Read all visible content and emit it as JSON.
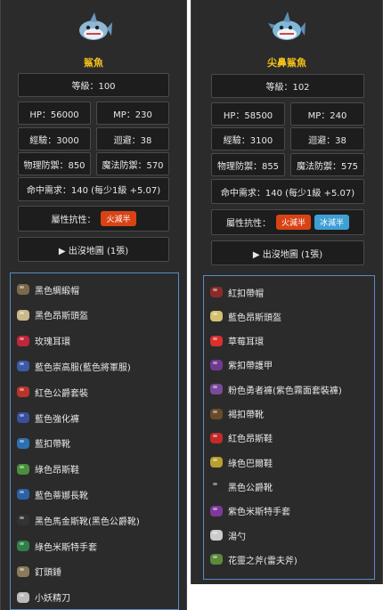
{
  "left": {
    "name": "鯊魚",
    "level": "等級：100",
    "hp": "HP：56000",
    "mp": "MP：230",
    "exp": "經驗：3000",
    "evasion": "迴避：38",
    "phys_def": "物理防禦：850",
    "magic_def": "魔法防禦：570",
    "accuracy": "命中需求：140 (每少1級 +5.07)",
    "attr_label": "屬性抗性：",
    "attr_badges": [
      "火減半"
    ],
    "map_button": "▶ 出沒地圖 (1張)",
    "drops": [
      "黑色綢緞帽",
      "黑色昂斯頭盔",
      "玫瑰耳環",
      "藍色崇高服(藍色將軍服)",
      "紅色公爵套裝",
      "藍色強化褲",
      "藍扣帶靴",
      "綠色昂斯鞋",
      "藍色蒂娜長靴",
      "黑色馬金斯靴(黑色公爵靴)",
      "綠色米斯特手套",
      "釘頭錘",
      "小妖精刀"
    ]
  },
  "right": {
    "name": "尖鼻鯊魚",
    "level": "等級：102",
    "hp": "HP：58500",
    "mp": "MP：240",
    "exp": "經驗：3100",
    "evasion": "迴避：38",
    "phys_def": "物理防禦：855",
    "magic_def": "魔法防禦：575",
    "accuracy": "命中需求：140 (每少1級 +5.07)",
    "attr_label": "屬性抗性：",
    "attr_badges": [
      "火減半",
      "冰減半"
    ],
    "map_button": "▶ 出沒地圖 (1張)",
    "drops": [
      "紅扣帶帽",
      "藍色昂斯頭盔",
      "草莓耳環",
      "紫扣帶護甲",
      "粉色勇者褲(紫色霧面套裝褲)",
      "褐扣帶靴",
      "紅色昂斯鞋",
      "綠色巴爾鞋",
      "黑色公爵靴",
      "紫色米斯特手套",
      "湯勺",
      "花靈之斧(雷夫斧)"
    ]
  },
  "colors": {
    "panel": "#2b2b2b",
    "title": "#f3c11b",
    "fire": "#d84315",
    "ice": "#3f9fd5",
    "list_border": "#5a8ac6"
  }
}
